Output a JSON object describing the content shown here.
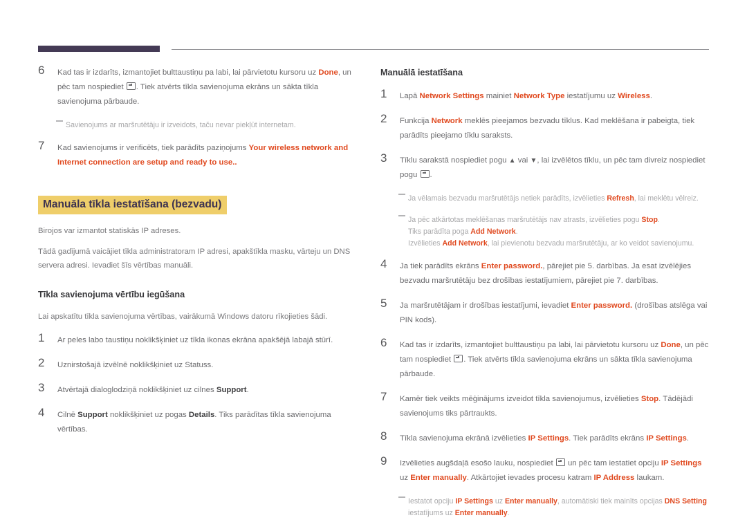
{
  "document": {
    "top_rule": {
      "accent_color": "#443a55",
      "line_color": "#8d8d91"
    },
    "colors": {
      "accent_red": "#e0491f",
      "highlight_yellow": "#efce6a",
      "heading_purple": "#3d3350",
      "body_gray": "#6a6a6d",
      "note_gray": "#a8a8aa"
    }
  },
  "left_column": {
    "step6": {
      "num": "6",
      "t1": "Kad tas ir izdarīts, izmantojiet bulttaustiņu pa labi, lai pārvietotu kursoru uz ",
      "b1": "Done",
      "t2": ", un pēc tam nospiediet ",
      "t3": ". Tiek atvērts tīkla savienojuma ekrāns un sākta tīkla savienojuma pārbaude."
    },
    "note1": {
      "text": "Savienojums ar maršrutētāju ir izveidots, taču nevar piekļūt internetam."
    },
    "step7": {
      "num": "7",
      "t1": "Kad savienojums ir verificēts, tiek parādīts paziņojums ",
      "b1": "Your wireless network and Internet connection are setup and ready to use",
      "t2": ".."
    },
    "heading_highlight": "Manuāla tīkla iestatīšana (bezvadu)",
    "para1": "Birojos var izmantot statiskās IP adreses.",
    "para2": "Tādā gadījumā vaicājiet tīkla administratoram IP adresi, apakštīkla masku, vārteju un DNS servera adresi. Ievadiet šīs vērtības manuāli.",
    "subheading": "Tīkla savienojuma vērtību iegūšana",
    "para3": "Lai apskatītu tīkla savienojuma vērtības, vairākumā Windows datoru rīkojieties šādi.",
    "step1": {
      "num": "1",
      "t1": "Ar peles labo taustiņu noklikšķiniet uz tīkla ikonas ekrāna apakšējā labajā stūrī."
    },
    "step2": {
      "num": "2",
      "t1": "Uznirstošajā izvēlnē noklikšķiniet uz Statuss."
    },
    "step3": {
      "num": "3",
      "t1": "Atvērtajā dialoglodziņā noklikšķiniet uz cilnes ",
      "b1": "Support",
      "t2": "."
    },
    "step4": {
      "num": "4",
      "t1": "Cilnē ",
      "b1": "Support",
      "t2": " noklikšķiniet uz pogas ",
      "b2": "Details",
      "t3": ". Tiks parādītas tīkla savienojuma vērtības."
    }
  },
  "right_column": {
    "heading": "Manuālā iestatīšana",
    "step1": {
      "num": "1",
      "t1": "Lapā ",
      "b1": "Network Settings",
      "t2": " mainiet ",
      "b2": "Network Type",
      "t3": " iestatījumu uz ",
      "b3": "Wireless",
      "t4": "."
    },
    "step2": {
      "num": "2",
      "t1": "Funkcija ",
      "b1": "Network",
      "t2": " meklēs pieejamos bezvadu tīklus. Kad meklēšana ir pabeigta, tiek parādīts pieejamo tīklu saraksts."
    },
    "step3": {
      "num": "3",
      "t1": "Tīklu sarakstā nospiediet pogu ",
      "t2": " vai ",
      "t3": ", lai izvēlētos tīklu, un pēc tam divreiz nospiediet pogu ",
      "t4": "."
    },
    "note1": {
      "t1": "Ja vēlamais bezvadu maršrutētājs netiek parādīts, izvēlieties ",
      "b1": "Refresh",
      "t2": ", lai meklētu vēlreiz."
    },
    "note2": {
      "t1": "Ja pēc atkārtotas meklēšanas maršrutētājs nav atrasts, izvēlieties pogu ",
      "b1": "Stop",
      "t2": ".",
      "l2_t1": "Tiks parādīta poga ",
      "l2_b1": "Add Network",
      "l2_t2": ".",
      "l3_t1": "Izvēlieties ",
      "l3_b1": "Add Network",
      "l3_t2": ", lai pievienotu bezvadu maršrutētāju, ar ko veidot savienojumu."
    },
    "step4": {
      "num": "4",
      "t1": "Ja tiek parādīts ekrāns ",
      "b1": "Enter password.",
      "t2": ", pārejiet pie 5. darbības. Ja esat izvēlējies bezvadu maršrutētāju bez drošības iestatījumiem, pārejiet pie 7. darbības."
    },
    "step5": {
      "num": "5",
      "t1": "Ja maršrutētājam ir drošības iestatījumi, ievadiet ",
      "b1": "Enter password.",
      "t2": " (drošības atslēga vai PIN kods)."
    },
    "step6": {
      "num": "6",
      "t1": "Kad tas ir izdarīts, izmantojiet bulttaustiņu pa labi, lai pārvietotu kursoru uz ",
      "b1": "Done",
      "t2": ", un pēc tam nospiediet ",
      "t3": ". Tiek atvērts tīkla savienojuma ekrāns un sākta tīkla savienojuma pārbaude."
    },
    "step7": {
      "num": "7",
      "t1": "Kamēr tiek veikts mēģinājums izveidot tīkla savienojumus, izvēlieties ",
      "b1": "Stop",
      "t2": ". Tādējādi savienojums tiks pārtraukts."
    },
    "step8": {
      "num": "8",
      "t1": "Tīkla savienojuma ekrānā izvēlieties ",
      "b1": "IP Settings",
      "t2": ". Tiek parādīts ekrāns ",
      "b2": "IP Settings",
      "t3": "."
    },
    "step9": {
      "num": "9",
      "t1": "Izvēlieties augšdaļā esošo lauku, nospiediet ",
      "t2": " un pēc tam iestatiet opciju ",
      "b1": "IP Settings",
      "t3": " uz ",
      "b2": "Enter manually",
      "t4": ". Atkārtojiet ievades procesu katram ",
      "b3": "IP Address",
      "t5": " laukam."
    },
    "note3": {
      "t1": "Iestatot opciju ",
      "b1": "IP Settings",
      "t2": " uz ",
      "b2": "Enter manually",
      "t3": ", automātiski tiek mainīts opcijas ",
      "b3": "DNS Setting",
      "l2_t1": "iestatījums uz ",
      "l2_b1": "Enter manually",
      "l2_t2": "."
    }
  },
  "icons": {
    "enter_key": "enter-key-icon",
    "arrow_up": "▲",
    "arrow_down": "▼"
  }
}
